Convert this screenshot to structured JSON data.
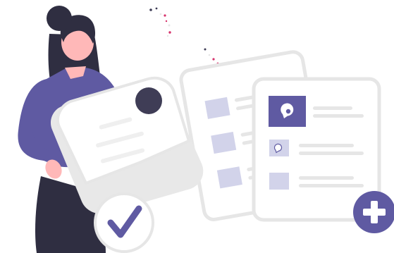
{
  "illustration": {
    "colors": {
      "accent": "#6C63FF",
      "accent_dark": "#5F5AA2",
      "accent_soft": "#D2D3EA",
      "skin": "#FFB8B8",
      "hair": "#2F2E41",
      "paper_border": "#E6E6E6",
      "paper_fill": "#FFFFFF",
      "paper_shadow": "#E8E8E8",
      "line_gray": "#E6E6E6",
      "confetti": [
        "#E6E6E6",
        "#D6336C",
        "#3F3D56",
        "#FF6584"
      ]
    },
    "icons": {
      "check_badge": "check-circle-icon",
      "add_badge": "plus-circle-icon",
      "profile_avatar": "chat-bubble-icon"
    },
    "documents": {
      "back_card_rows": 3,
      "front_card_rows": 3
    }
  }
}
